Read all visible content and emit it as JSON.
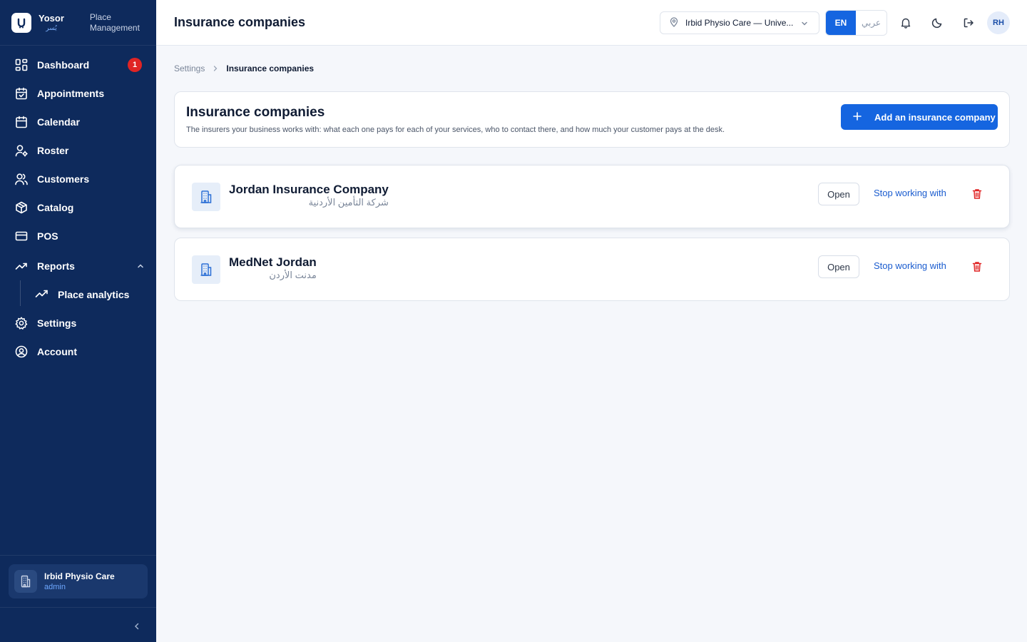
{
  "brand": {
    "name": "Yosor",
    "name_ar": "يُسر",
    "subtitle_line1": "Place",
    "subtitle_line2": "Management"
  },
  "sidebar": {
    "items": [
      {
        "label": "Dashboard",
        "icon": "grid-icon",
        "badge": "1"
      },
      {
        "label": "Appointments",
        "icon": "calendar-check-icon"
      },
      {
        "label": "Calendar",
        "icon": "calendar-icon"
      },
      {
        "label": "Roster",
        "icon": "user-gear-icon"
      },
      {
        "label": "Customers",
        "icon": "users-icon"
      },
      {
        "label": "Catalog",
        "icon": "package-icon"
      },
      {
        "label": "POS",
        "icon": "credit-card-icon"
      },
      {
        "label": "Reports",
        "icon": "trending-up-icon",
        "expanded": true,
        "children": [
          {
            "label": "Place analytics",
            "icon": "trending-up-icon"
          }
        ]
      },
      {
        "label": "Settings",
        "icon": "gear-icon"
      },
      {
        "label": "Account",
        "icon": "user-circle-icon"
      }
    ],
    "org": {
      "name": "Irbid Physio Care",
      "role": "admin"
    }
  },
  "topbar": {
    "title": "Insurance companies",
    "branch": "Irbid Physio Care — Unive...",
    "lang_en": "EN",
    "lang_ar": "عربي",
    "avatar_initials": "RH"
  },
  "breadcrumb": {
    "parent": "Settings",
    "current": "Insurance companies"
  },
  "header": {
    "title": "Insurance companies",
    "description": "The insurers your business works with: what each one pays for each of your services, who to contact there, and how much your customer pays at the desk.",
    "add_button": "Add an insurance company"
  },
  "companies": [
    {
      "name": "Jordan Insurance Company",
      "name_ar": "شركة التأمين الأردنية",
      "open_label": "Open",
      "stop_label": "Stop working with"
    },
    {
      "name": "MedNet Jordan",
      "name_ar": "مدنت الأردن",
      "open_label": "Open",
      "stop_label": "Stop working with"
    }
  ],
  "colors": {
    "sidebar_bg": "#0e2a5c",
    "primary": "#1565e0",
    "danger": "#e02424",
    "page_bg": "#f5f7fb"
  }
}
